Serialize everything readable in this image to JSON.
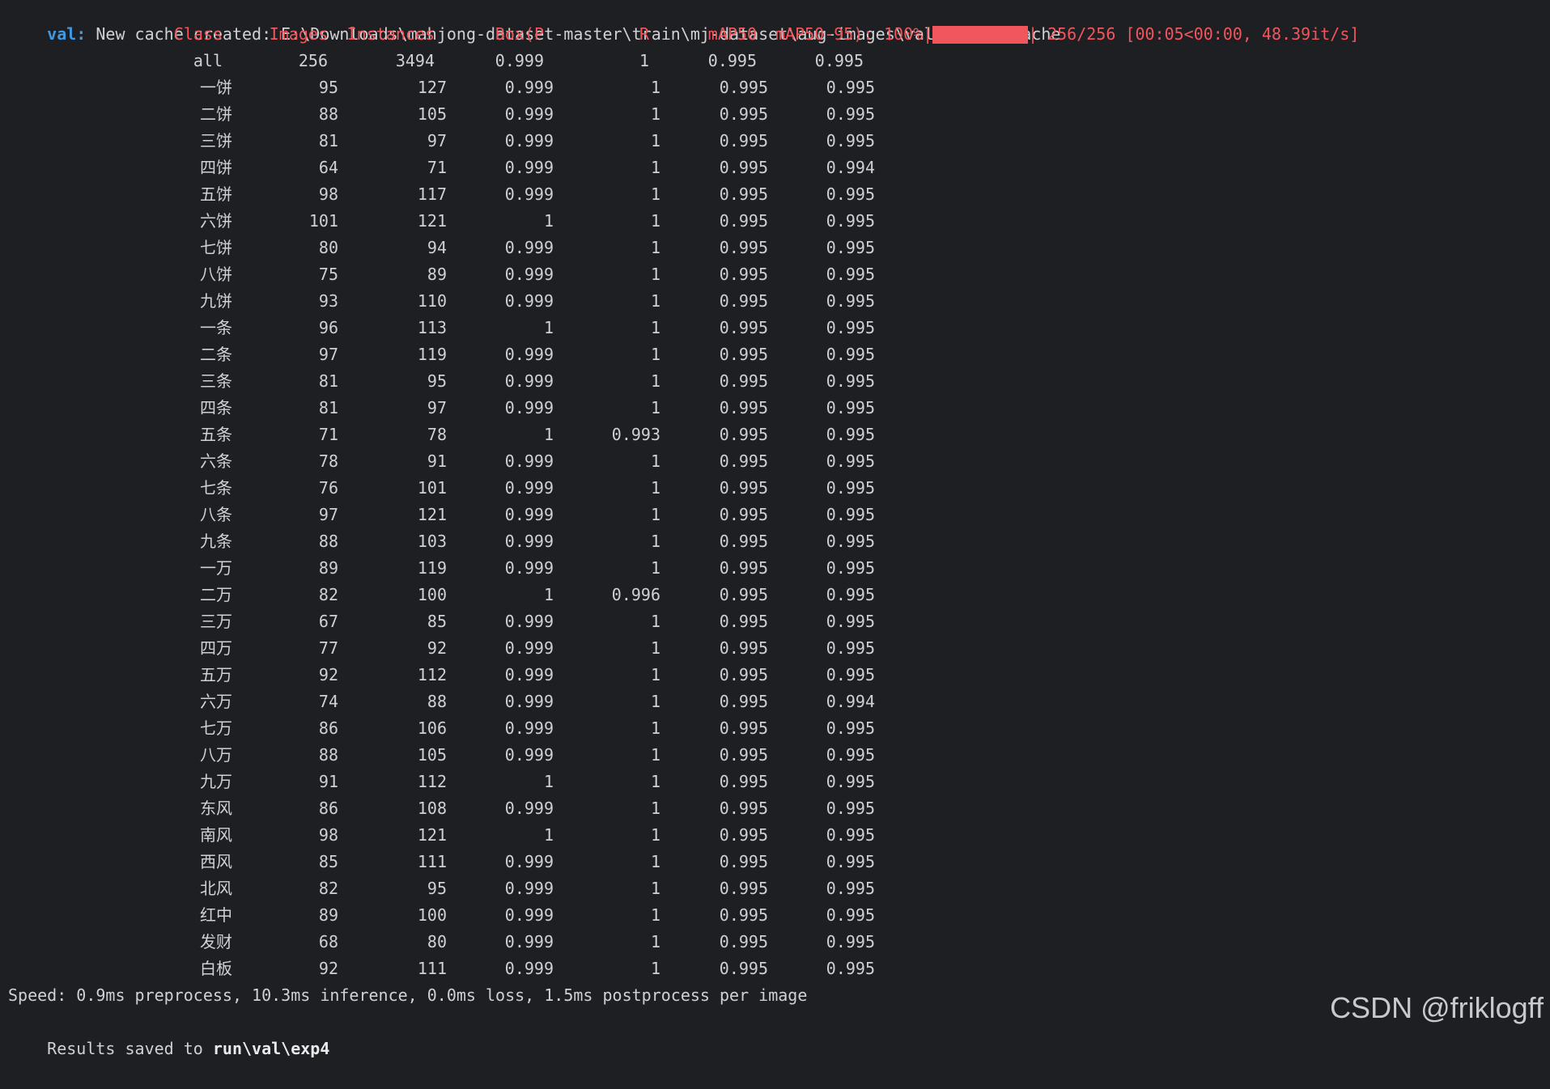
{
  "cache_line": {
    "prefix": "val:",
    "text": " New cache created: E:\\Downloads\\mahjong-dataset-master\\train\\mj-dataset\\aug-images\\val\\labels.cache"
  },
  "header": {
    "class": "Class",
    "images": "Images",
    "instances": "Instances",
    "box_p": "Box(P",
    "r": "R",
    "map50": "mAP50",
    "map50_95": "mAP50-95):",
    "percent": "100%|",
    "progress_value": 1.0,
    "progress_suffix": "| 256/256 [00:05<00:00, 48.39it/s]"
  },
  "summary": {
    "class": "all",
    "images": "256",
    "instances": "3494",
    "p": "0.999",
    "r": "1",
    "map50": "0.995",
    "map50_95": "0.995"
  },
  "rows": [
    {
      "class": "一饼",
      "images": "95",
      "instances": "127",
      "p": "0.999",
      "r": "1",
      "map50": "0.995",
      "map50_95": "0.995"
    },
    {
      "class": "二饼",
      "images": "88",
      "instances": "105",
      "p": "0.999",
      "r": "1",
      "map50": "0.995",
      "map50_95": "0.995"
    },
    {
      "class": "三饼",
      "images": "81",
      "instances": "97",
      "p": "0.999",
      "r": "1",
      "map50": "0.995",
      "map50_95": "0.995"
    },
    {
      "class": "四饼",
      "images": "64",
      "instances": "71",
      "p": "0.999",
      "r": "1",
      "map50": "0.995",
      "map50_95": "0.994"
    },
    {
      "class": "五饼",
      "images": "98",
      "instances": "117",
      "p": "0.999",
      "r": "1",
      "map50": "0.995",
      "map50_95": "0.995"
    },
    {
      "class": "六饼",
      "images": "101",
      "instances": "121",
      "p": "1",
      "r": "1",
      "map50": "0.995",
      "map50_95": "0.995"
    },
    {
      "class": "七饼",
      "images": "80",
      "instances": "94",
      "p": "0.999",
      "r": "1",
      "map50": "0.995",
      "map50_95": "0.995"
    },
    {
      "class": "八饼",
      "images": "75",
      "instances": "89",
      "p": "0.999",
      "r": "1",
      "map50": "0.995",
      "map50_95": "0.995"
    },
    {
      "class": "九饼",
      "images": "93",
      "instances": "110",
      "p": "0.999",
      "r": "1",
      "map50": "0.995",
      "map50_95": "0.995"
    },
    {
      "class": "一条",
      "images": "96",
      "instances": "113",
      "p": "1",
      "r": "1",
      "map50": "0.995",
      "map50_95": "0.995"
    },
    {
      "class": "二条",
      "images": "97",
      "instances": "119",
      "p": "0.999",
      "r": "1",
      "map50": "0.995",
      "map50_95": "0.995"
    },
    {
      "class": "三条",
      "images": "81",
      "instances": "95",
      "p": "0.999",
      "r": "1",
      "map50": "0.995",
      "map50_95": "0.995"
    },
    {
      "class": "四条",
      "images": "81",
      "instances": "97",
      "p": "0.999",
      "r": "1",
      "map50": "0.995",
      "map50_95": "0.995"
    },
    {
      "class": "五条",
      "images": "71",
      "instances": "78",
      "p": "1",
      "r": "0.993",
      "map50": "0.995",
      "map50_95": "0.995"
    },
    {
      "class": "六条",
      "images": "78",
      "instances": "91",
      "p": "0.999",
      "r": "1",
      "map50": "0.995",
      "map50_95": "0.995"
    },
    {
      "class": "七条",
      "images": "76",
      "instances": "101",
      "p": "0.999",
      "r": "1",
      "map50": "0.995",
      "map50_95": "0.995"
    },
    {
      "class": "八条",
      "images": "97",
      "instances": "121",
      "p": "0.999",
      "r": "1",
      "map50": "0.995",
      "map50_95": "0.995"
    },
    {
      "class": "九条",
      "images": "88",
      "instances": "103",
      "p": "0.999",
      "r": "1",
      "map50": "0.995",
      "map50_95": "0.995"
    },
    {
      "class": "一万",
      "images": "89",
      "instances": "119",
      "p": "0.999",
      "r": "1",
      "map50": "0.995",
      "map50_95": "0.995"
    },
    {
      "class": "二万",
      "images": "82",
      "instances": "100",
      "p": "1",
      "r": "0.996",
      "map50": "0.995",
      "map50_95": "0.995"
    },
    {
      "class": "三万",
      "images": "67",
      "instances": "85",
      "p": "0.999",
      "r": "1",
      "map50": "0.995",
      "map50_95": "0.995"
    },
    {
      "class": "四万",
      "images": "77",
      "instances": "92",
      "p": "0.999",
      "r": "1",
      "map50": "0.995",
      "map50_95": "0.995"
    },
    {
      "class": "五万",
      "images": "92",
      "instances": "112",
      "p": "0.999",
      "r": "1",
      "map50": "0.995",
      "map50_95": "0.995"
    },
    {
      "class": "六万",
      "images": "74",
      "instances": "88",
      "p": "0.999",
      "r": "1",
      "map50": "0.995",
      "map50_95": "0.994"
    },
    {
      "class": "七万",
      "images": "86",
      "instances": "106",
      "p": "0.999",
      "r": "1",
      "map50": "0.995",
      "map50_95": "0.995"
    },
    {
      "class": "八万",
      "images": "88",
      "instances": "105",
      "p": "0.999",
      "r": "1",
      "map50": "0.995",
      "map50_95": "0.995"
    },
    {
      "class": "九万",
      "images": "91",
      "instances": "112",
      "p": "1",
      "r": "1",
      "map50": "0.995",
      "map50_95": "0.995"
    },
    {
      "class": "东风",
      "images": "86",
      "instances": "108",
      "p": "0.999",
      "r": "1",
      "map50": "0.995",
      "map50_95": "0.995"
    },
    {
      "class": "南风",
      "images": "98",
      "instances": "121",
      "p": "1",
      "r": "1",
      "map50": "0.995",
      "map50_95": "0.995"
    },
    {
      "class": "西风",
      "images": "85",
      "instances": "111",
      "p": "0.999",
      "r": "1",
      "map50": "0.995",
      "map50_95": "0.995"
    },
    {
      "class": "北风",
      "images": "82",
      "instances": "95",
      "p": "0.999",
      "r": "1",
      "map50": "0.995",
      "map50_95": "0.995"
    },
    {
      "class": "红中",
      "images": "89",
      "instances": "100",
      "p": "0.999",
      "r": "1",
      "map50": "0.995",
      "map50_95": "0.995"
    },
    {
      "class": "发财",
      "images": "68",
      "instances": "80",
      "p": "0.999",
      "r": "1",
      "map50": "0.995",
      "map50_95": "0.995"
    },
    {
      "class": "白板",
      "images": "92",
      "instances": "111",
      "p": "0.999",
      "r": "1",
      "map50": "0.995",
      "map50_95": "0.995"
    }
  ],
  "footer": {
    "speed": "Speed: 0.9ms preprocess, 10.3ms inference, 0.0ms loss, 1.5ms postprocess per image",
    "results_prefix": "Results saved to ",
    "results_path": "run\\val\\exp4"
  },
  "watermark": "CSDN @friklogff",
  "colors": {
    "background": "#1e1f22",
    "text": "#cfd1d4",
    "header": "#f0565c",
    "prefix": "#3f9ae4"
  }
}
